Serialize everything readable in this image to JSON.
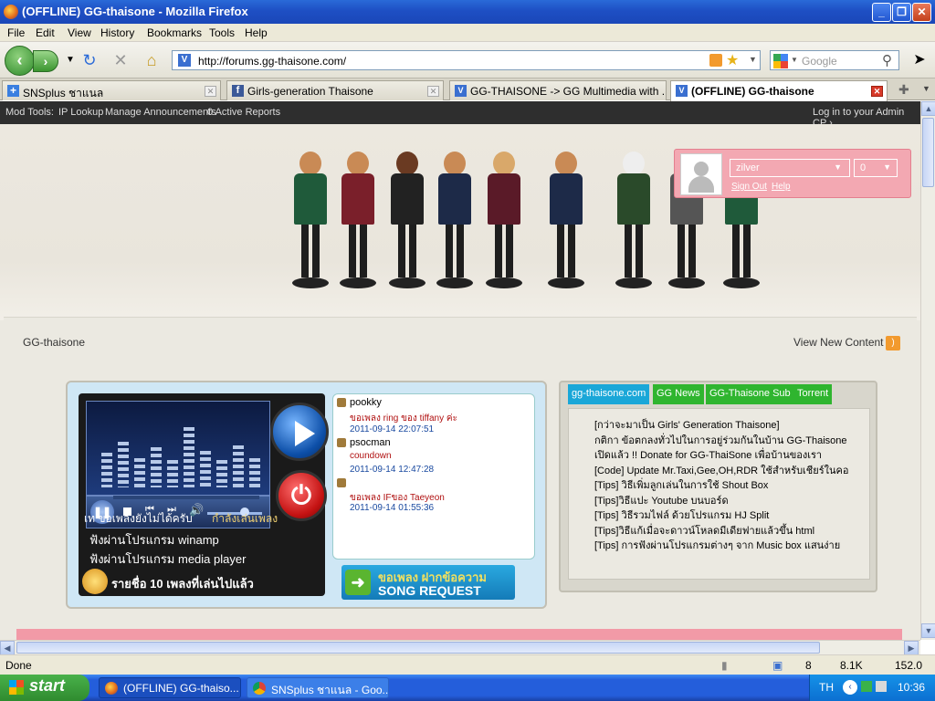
{
  "window": {
    "title": "(OFFLINE) GG-thaisone - Mozilla Firefox"
  },
  "menu": [
    "File",
    "Edit",
    "View",
    "History",
    "Bookmarks",
    "Tools",
    "Help"
  ],
  "nav": {
    "url": "http://forums.gg-thaisone.com/",
    "search_placeholder": "Google"
  },
  "tabs": [
    {
      "label": "SNSplus ชาแนล"
    },
    {
      "label": "Girls-generation Thaisone"
    },
    {
      "label": "GG-THAISONE -> GG Multimedia with ..."
    },
    {
      "label": "(OFFLINE) GG-thaisone"
    }
  ],
  "modbar": {
    "label": "Mod Tools:",
    "ip": "IP Lookup",
    "ann": "Manage Announcements",
    "reports": "0 Active Reports",
    "admin": "Log in to your Admin CP ›"
  },
  "user": {
    "name": "zilver",
    "count": "0",
    "signout": "Sign Out",
    "help": "Help"
  },
  "site": {
    "title": "GG-thaisone",
    "view_new": "View New Content"
  },
  "player": {
    "line1": "เท ขอเพลงยังไม่ได้ครับ",
    "line1b": "กำลังเล่นเพลง",
    "line2": "ฟังผ่านโปรแกรม winamp",
    "line3": "ฟังผ่านโปรแกรม media player",
    "line4": "รายชื่อ 10 เพลงที่เล่นไปแล้ว",
    "req_th": "ขอเพลง ฝากข้อความ",
    "req_en": "SONG REQUEST",
    "requests": [
      {
        "user": "pookky",
        "msg": "ขอเพลง ring ของ tiffany ค่ะ",
        "time": "2011-09-14 22:07:51"
      },
      {
        "user": "psocman",
        "msg": "coundown",
        "time": "2011-09-14 12:47:28"
      },
      {
        "user": "",
        "msg": "ขอเพลง IFของ Taeyeon",
        "time": "2011-09-14 01:55:36"
      }
    ]
  },
  "news": {
    "tabs": [
      {
        "label": "gg-thaisone.com",
        "color": "#1aa7d8"
      },
      {
        "label": "GG News",
        "color": "#2fb52f"
      },
      {
        "label": "GG-Thaisone Sub",
        "color": "#2fb52f"
      },
      {
        "label": "Torrent",
        "color": "#2fb52f"
      }
    ],
    "items": [
      "[กว่าจะมาเป็น Girls' Generation Thaisone]",
      "กติกา ข้อตกลงทั่วไปในการอยู่ร่วมกันในบ้าน GG-Thaisone",
      "เปิดแล้ว !! Donate for GG-ThaiSone เพื่อบ้านของเรา",
      "[Code] Update Mr.Taxi,Gee,OH,RDR ใช้สำหรับเชียร์ในคอ",
      "[Tips] วิธีเพิ่มลูกเล่นในการใช้ Shout Box",
      "[Tips]วิธีแปะ Youtube บนบอร์ด",
      "[Tips] วิธีรวมไฟล์ ด้วยโปรแกรม HJ Split",
      "[Tips]วิธีแก้เมื่อจะดาวน์โหลดมีเดียฟายแล้วขึ้น html",
      "[Tips] การฟังผ่านโปรแกรมต่างๆ จาก Music box แสนง่าย"
    ]
  },
  "status": {
    "text": "Done",
    "n1": "8",
    "n2": "8.1K",
    "n3": "152.0"
  },
  "taskbar": {
    "start": "start",
    "task1": "(OFFLINE) GG-thaiso...",
    "task2": "SNSplus ชาแนล - Goo...",
    "lang": "TH",
    "clock": "10:36"
  },
  "colors": {
    "accent": "#245edb",
    "pink": "#f3a8b2",
    "green": "#2fb52f",
    "cyan": "#1aa7d8"
  }
}
